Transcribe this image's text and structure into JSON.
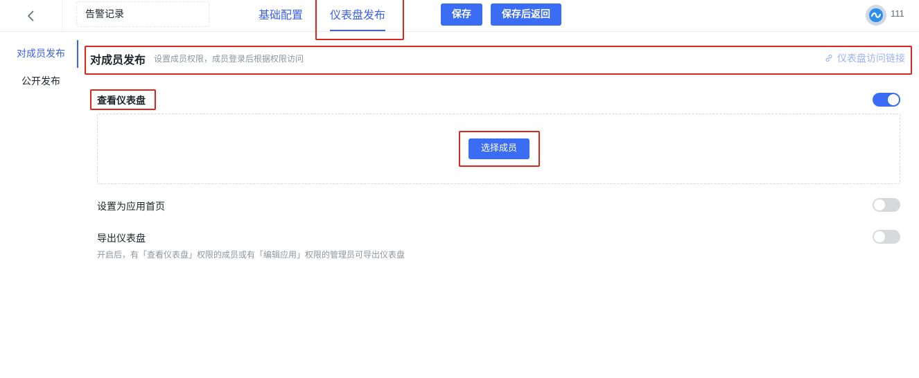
{
  "header": {
    "back_icon": "chevron-left-icon",
    "title_value": "告警记录",
    "tabs": [
      {
        "label": "基础配置",
        "active": false
      },
      {
        "label": "仪表盘发布",
        "active": true
      }
    ],
    "save_label": "保存",
    "save_return_label": "保存后返回",
    "user": {
      "avatar_icon": "user-avatar-icon",
      "name": "111"
    }
  },
  "sidebar": {
    "items": [
      {
        "label": "对成员发布",
        "active": true
      },
      {
        "label": "公开发布",
        "active": false
      }
    ]
  },
  "section": {
    "title": "对成员发布",
    "description": "设置成员权限，成员登录后根据权限访问",
    "link_label": "仪表盘访问链接",
    "link_icon": "link-icon"
  },
  "settings": {
    "view_dashboard": {
      "label": "查看仪表盘",
      "enabled": true
    },
    "select_members_label": "选择成员",
    "set_home": {
      "label": "设置为应用首页",
      "enabled": false
    },
    "export_dashboard": {
      "label": "导出仪表盘",
      "description": "开启后，有「查看仪表盘」权限的成员或有「编辑应用」权限的管理员可导出仪表盘",
      "enabled": false
    }
  },
  "colors": {
    "accent": "#3a6cf4",
    "annotation": "#e0261b"
  }
}
